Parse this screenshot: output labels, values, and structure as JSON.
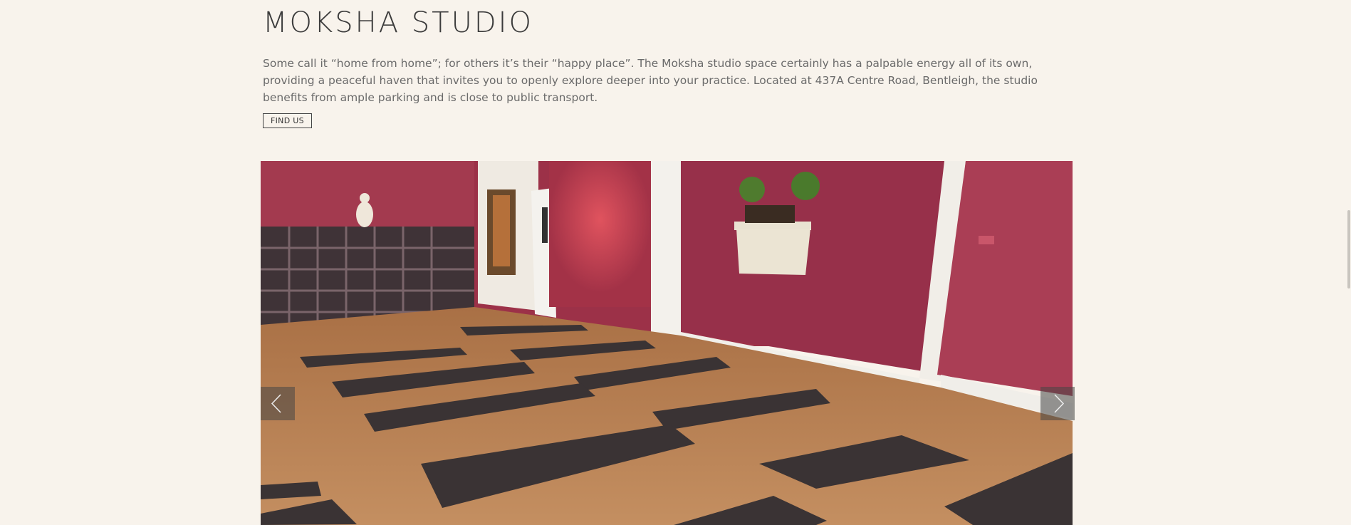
{
  "section": {
    "title": "MOKSHA STUDIO",
    "intro": "Some call it “home from home”; for others it’s their “happy place”. The Moksha studio space certainly has a palpable energy all of its own, providing a peaceful haven that invites you to openly explore deeper into your practice. Located at 437A Centre Road, Bentleigh, the studio benefits from ample parking and is close to public transport.",
    "find_button": "FIND US"
  },
  "gallery": {
    "prev_icon": "chevron-left-icon",
    "next_icon": "chevron-right-icon"
  },
  "colors": {
    "background": "#f8f3ec",
    "wall": "#9c2f47",
    "floor": "#b98152",
    "mat": "#3a3334",
    "trim": "#f1efe9"
  }
}
